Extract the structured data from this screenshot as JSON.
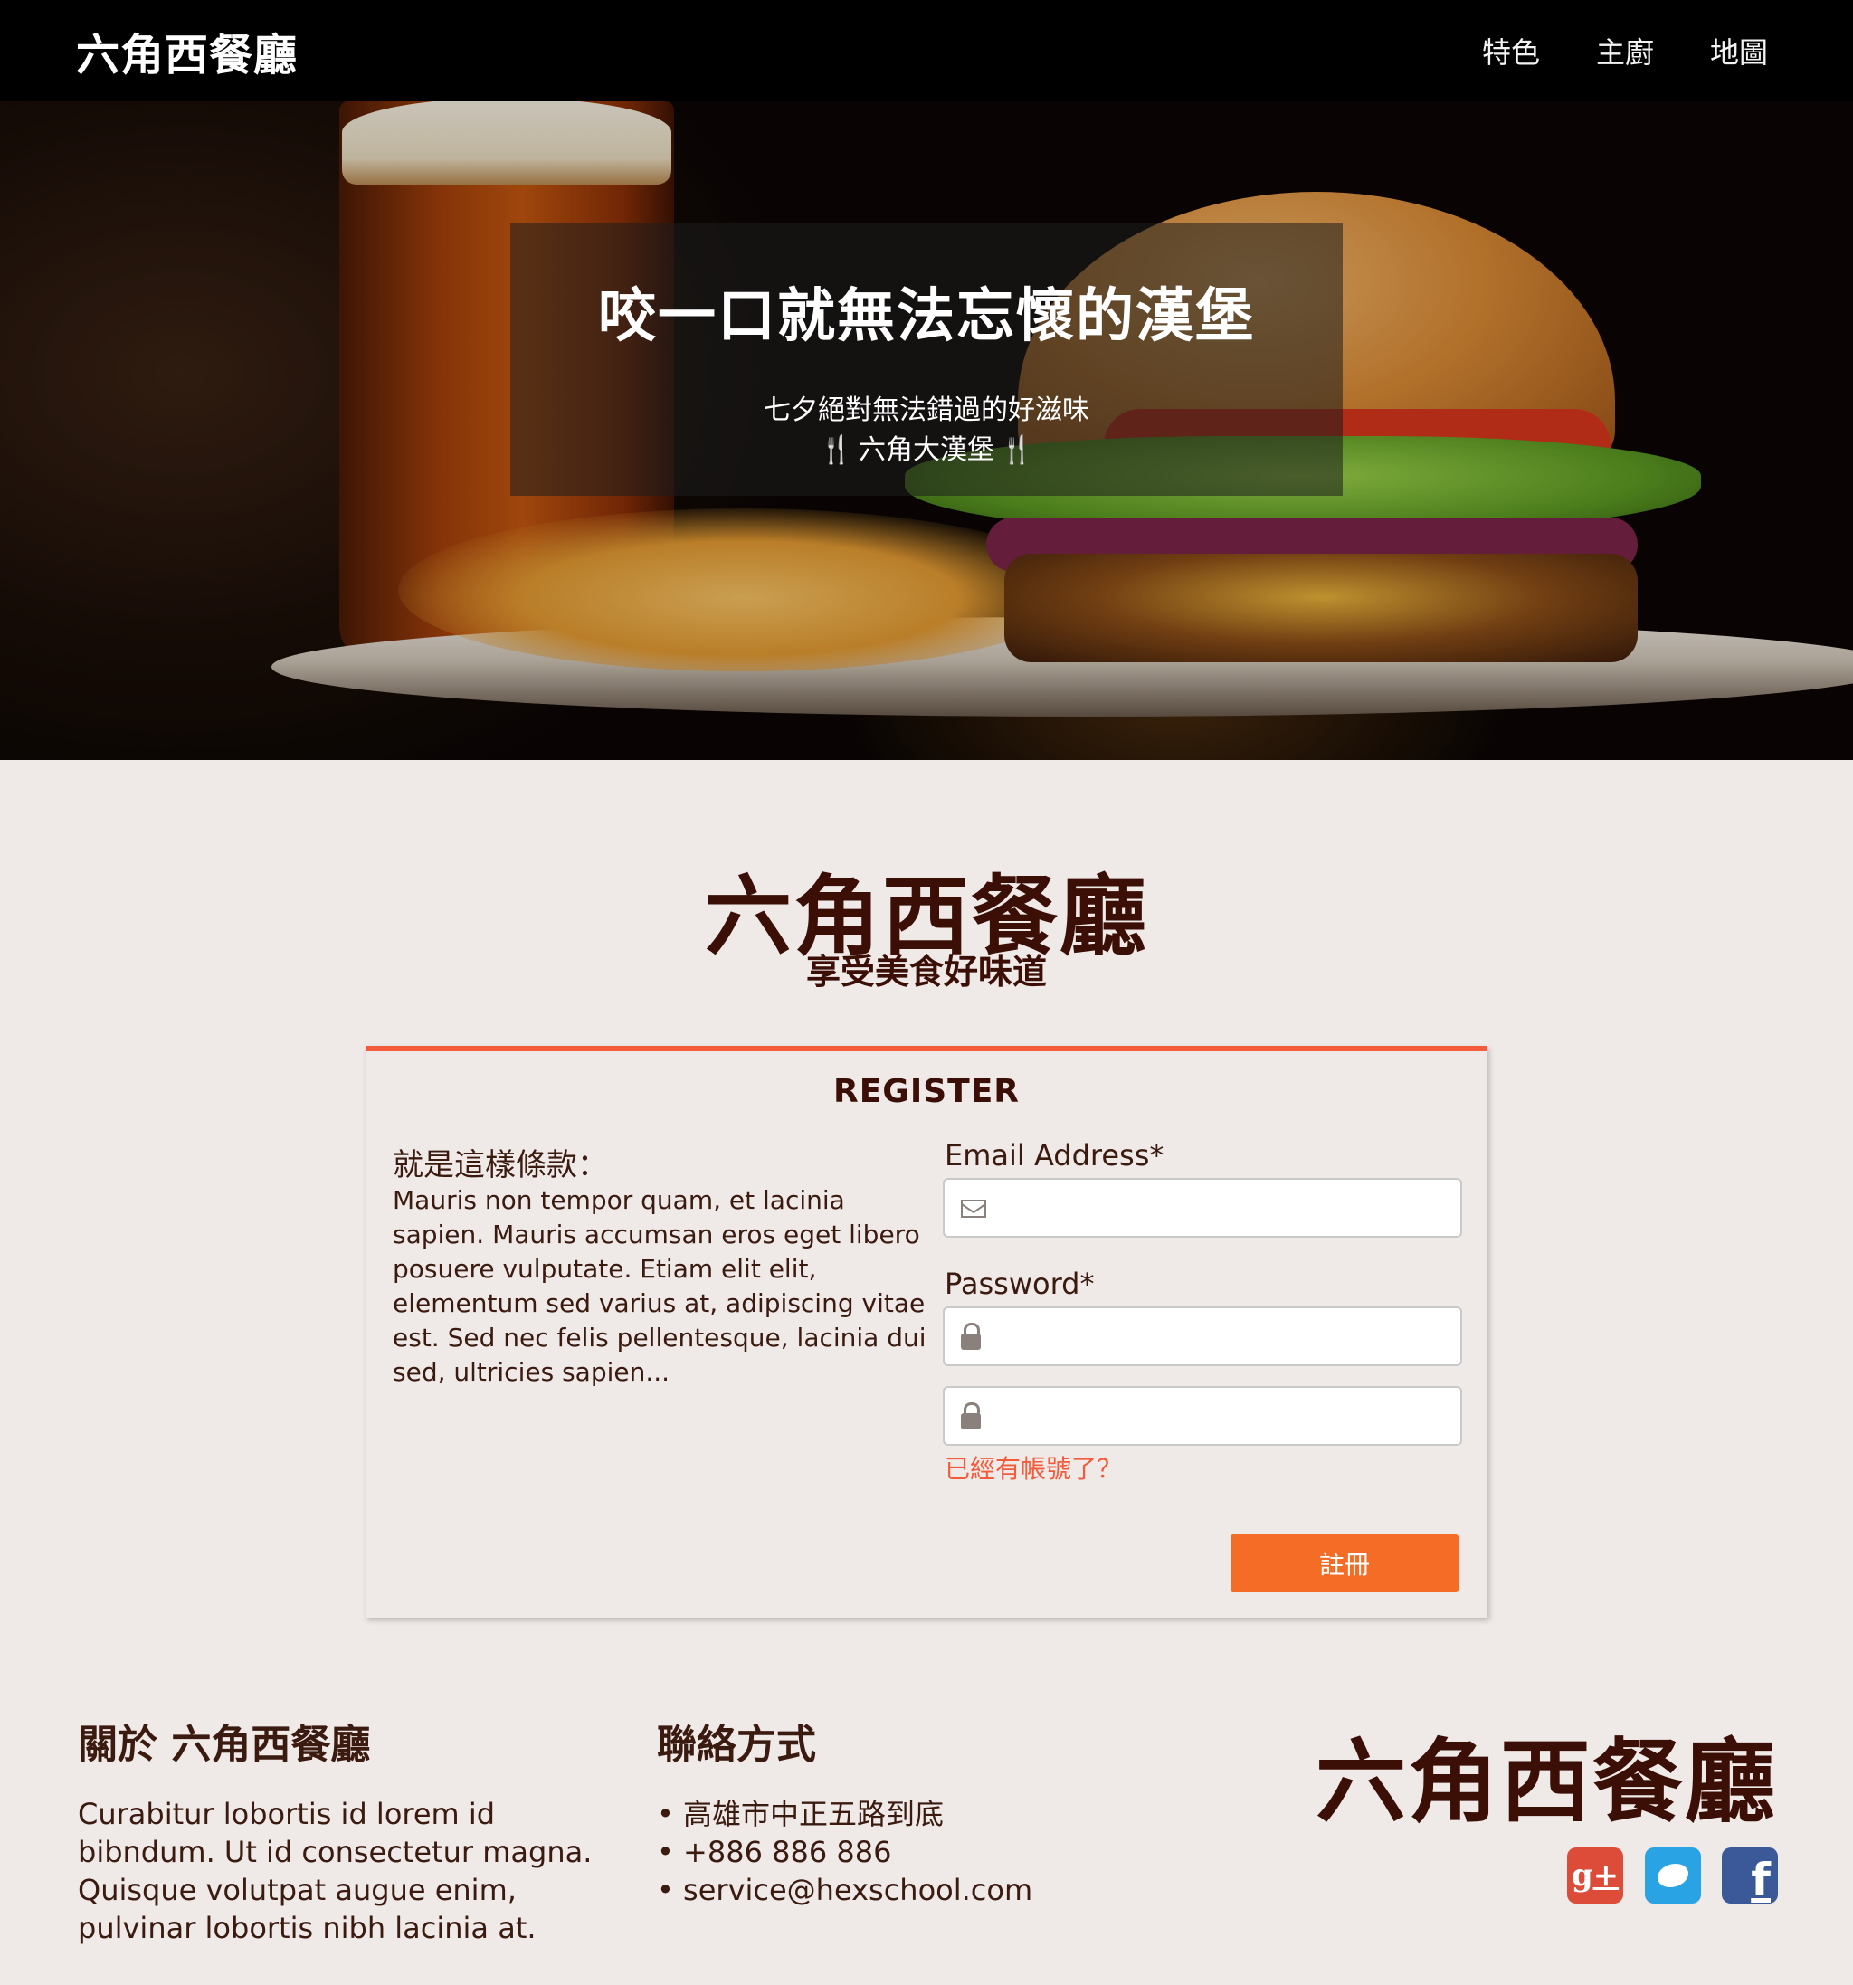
{
  "nav": {
    "brand": "六角西餐廳",
    "items": [
      "特色",
      "主廚",
      "地圖"
    ]
  },
  "hero": {
    "title": "咬一口就無法忘懷的漢堡",
    "subtitle": "七夕絕對無法錯過的好滋味",
    "tagline": "六角大漢堡",
    "fork_icon": "fork-knife-icon"
  },
  "brand": {
    "title": "六角西餐廳",
    "subtitle": "享受美食好味道"
  },
  "register": {
    "title": "REGISTER",
    "terms_title": "就是這樣條款：",
    "terms_text": "Mauris non tempor quam, et lacinia sapien. Mauris accumsan eros eget libero posuere vulputate. Etiam elit elit, elementum sed varius at, adipiscing vitae est. Sed nec felis pellentesque, lacinia dui sed, ultricies sapien...",
    "email_label": "Email Address*",
    "email_value": "",
    "password_label": "Password*",
    "password_value": "",
    "confirm_value": "",
    "account_link": "已經有帳號了？",
    "submit_label": "註冊"
  },
  "footer": {
    "about_title": "關於 六角西餐廳",
    "about_text": "Curabitur lobortis id lorem id bibndum. Ut id consectetur magna. Quisque volutpat augue enim, pulvinar lobortis nibh lacinia at.",
    "contact_title": "聯絡方式",
    "contacts": [
      "高雄市中正五路到底",
      "+886 886 886",
      "service@hexschool.com"
    ],
    "brand": "六角西餐廳",
    "social": [
      "google-plus-icon",
      "twitter-icon",
      "facebook-icon"
    ]
  },
  "colors": {
    "accent": "#f35b3b",
    "button": "#f46c26",
    "brand_text": "#3b0f06",
    "page_bg": "#efe9e7"
  }
}
